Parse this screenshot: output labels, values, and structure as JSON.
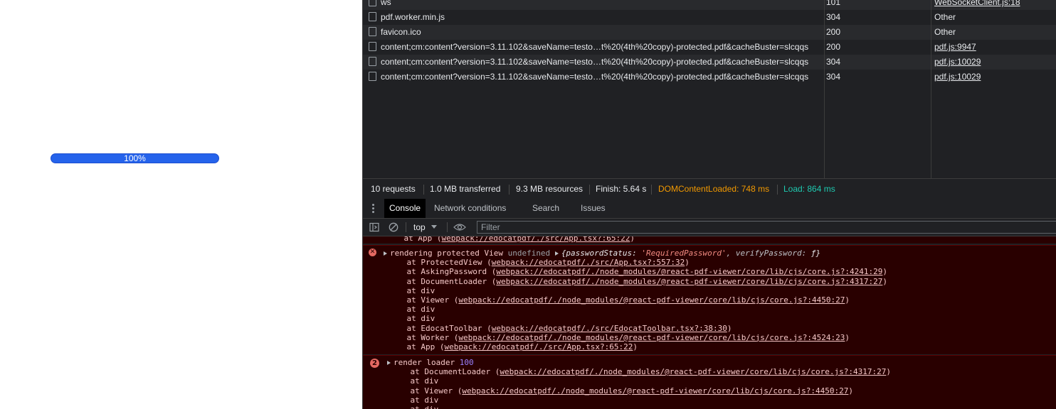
{
  "page": {
    "progress_percent": 100,
    "progress_label": "100%"
  },
  "network": {
    "rows": [
      {
        "name": "ws",
        "status": "101",
        "initiator": "WebSocketClient.js:18",
        "initiator_link": true
      },
      {
        "name": "pdf.worker.min.js",
        "status": "304",
        "initiator": "Other",
        "initiator_link": false
      },
      {
        "name": "favicon.ico",
        "status": "200",
        "initiator": "Other",
        "initiator_link": false
      },
      {
        "name": "content;cm:content?version=3.11.102&saveName=testo…t%20(4th%20copy)-protected.pdf&cacheBuster=slcqqs",
        "status": "200",
        "initiator": "pdf.js:9947",
        "initiator_link": true
      },
      {
        "name": "content;cm:content?version=3.11.102&saveName=testo…t%20(4th%20copy)-protected.pdf&cacheBuster=slcqqs",
        "status": "304",
        "initiator": "pdf.js:10029",
        "initiator_link": true
      },
      {
        "name": "content;cm:content?version=3.11.102&saveName=testo…t%20(4th%20copy)-protected.pdf&cacheBuster=slcqqs",
        "status": "304",
        "initiator": "pdf.js:10029",
        "initiator_link": true
      }
    ],
    "summary": {
      "requests": "10 requests",
      "transferred": "1.0 MB transferred",
      "resources": "9.3 MB resources",
      "finish": "Finish: 5.64 s",
      "dom_content_loaded": "DOMContentLoaded: 748 ms",
      "load": "Load: 864 ms"
    },
    "colors": {
      "dcl": "#f29900",
      "load": "#1ec9b0"
    }
  },
  "drawer": {
    "tabs": [
      "Console",
      "Network conditions",
      "Search",
      "Issues"
    ],
    "active_tab": "Console"
  },
  "console_toolbar": {
    "context": "top",
    "filter_placeholder": "Filter",
    "icons": [
      "sidebar-icon",
      "clear-console-icon",
      "eye-icon"
    ]
  },
  "console": {
    "top_partial_line": {
      "text": "    at App (",
      "link": "webpack://edocatpdf/./src/App.tsx?:65:22",
      "suffix": ")"
    },
    "entry1": {
      "message": "rendering protected View",
      "undefined": "undefined",
      "object_open": "{passwordStatus: ",
      "object_value": "'RequiredPassword'",
      "object_mid": ", verifyPassword: ",
      "object_end": "ƒ}",
      "stack": [
        {
          "pre": "    at ProtectedView (",
          "link": "webpack://edocatpdf/./src/App.tsx?:557:32",
          "post": ")"
        },
        {
          "pre": "    at AskingPassword (",
          "link": "webpack://edocatpdf/./node_modules/@react-pdf-viewer/core/lib/cjs/core.js?:4241:29",
          "post": ")"
        },
        {
          "pre": "    at DocumentLoader (",
          "link": "webpack://edocatpdf/./node_modules/@react-pdf-viewer/core/lib/cjs/core.js?:4317:27",
          "post": ")"
        },
        {
          "pre": "    at div",
          "link": "",
          "post": ""
        },
        {
          "pre": "    at Viewer (",
          "link": "webpack://edocatpdf/./node_modules/@react-pdf-viewer/core/lib/cjs/core.js?:4450:27",
          "post": ")"
        },
        {
          "pre": "    at div",
          "link": "",
          "post": ""
        },
        {
          "pre": "    at div",
          "link": "",
          "post": ""
        },
        {
          "pre": "    at EdocatToolbar (",
          "link": "webpack://edocatpdf/./src/EdocatToolbar.tsx?:38:30",
          "post": ")"
        },
        {
          "pre": "    at Worker (",
          "link": "webpack://edocatpdf/./node_modules/@react-pdf-viewer/core/lib/cjs/core.js?:4524:23",
          "post": ")"
        },
        {
          "pre": "    at App (",
          "link": "webpack://edocatpdf/./src/App.tsx?:65:22",
          "post": ")"
        }
      ]
    },
    "entry2": {
      "count": "2",
      "message": "render loader ",
      "value": "100",
      "stack": [
        {
          "pre": "    at DocumentLoader (",
          "link": "webpack://edocatpdf/./node_modules/@react-pdf-viewer/core/lib/cjs/core.js?:4317:27",
          "post": ")"
        },
        {
          "pre": "    at div",
          "link": "",
          "post": ""
        },
        {
          "pre": "    at Viewer (",
          "link": "webpack://edocatpdf/./node_modules/@react-pdf-viewer/core/lib/cjs/core.js?:4450:27",
          "post": ")"
        },
        {
          "pre": "    at div",
          "link": "",
          "post": ""
        },
        {
          "pre": "    at div",
          "link": "",
          "post": ""
        }
      ]
    }
  }
}
